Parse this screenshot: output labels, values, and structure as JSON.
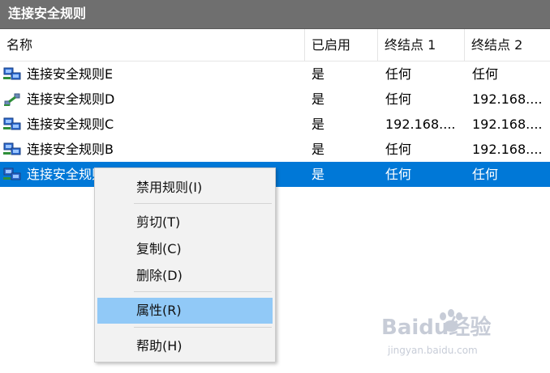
{
  "window": {
    "title": "连接安全规则"
  },
  "columns": [
    "名称",
    "已启用",
    "终结点 1",
    "终结点 2"
  ],
  "rows": [
    {
      "name": "连接安全规则E",
      "enabled": "是",
      "endpoint1": "任何",
      "endpoint2": "任何",
      "icon": "network-rule-icon"
    },
    {
      "name": "连接安全规则D",
      "enabled": "是",
      "endpoint1": "任何",
      "endpoint2": "192.168....",
      "icon": "tunnel-rule-icon"
    },
    {
      "name": "连接安全规则C",
      "enabled": "是",
      "endpoint1": "192.168....",
      "endpoint2": "192.168....",
      "icon": "network-rule-icon"
    },
    {
      "name": "连接安全规则B",
      "enabled": "是",
      "endpoint1": "任何",
      "endpoint2": "192.168....",
      "icon": "network-rule-icon"
    },
    {
      "name": "连接安全规则A",
      "enabled": "是",
      "endpoint1": "任何",
      "endpoint2": "任何",
      "icon": "network-rule-icon",
      "selected": true
    }
  ],
  "context_menu": {
    "items": [
      "禁用规则(I)",
      "剪切(T)",
      "复制(C)",
      "删除(D)",
      "属性(R)",
      "帮助(H)"
    ],
    "highlighted": "属性(R)"
  },
  "watermark": {
    "brand": "Baidu经验",
    "url": "jingyan.baidu.com"
  },
  "colors": {
    "title_bar": "#6f6f6f",
    "selection": "#0078d7",
    "menu_hover": "#91c9f7",
    "menu_bg": "#f2f2f2"
  }
}
